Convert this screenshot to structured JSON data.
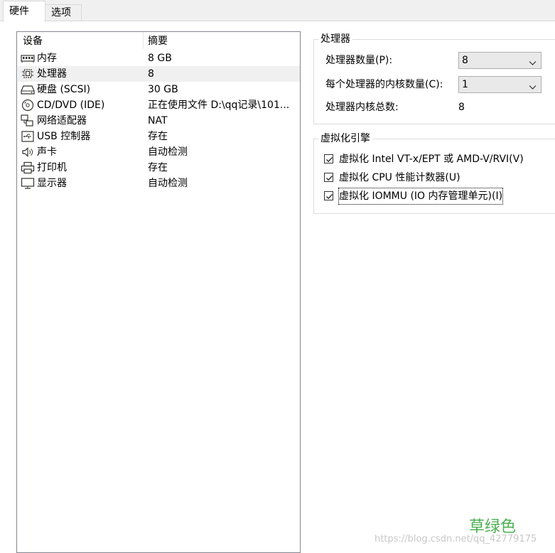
{
  "tabs": [
    {
      "label": "硬件",
      "active": true
    },
    {
      "label": "选项",
      "active": false
    }
  ],
  "device_list": {
    "columns": {
      "device": "设备",
      "summary": "摘要"
    },
    "rows": [
      {
        "icon": "memory-icon",
        "name": "内存",
        "summary": "8 GB",
        "selected": false
      },
      {
        "icon": "processor-icon",
        "name": "处理器",
        "summary": "8",
        "selected": true
      },
      {
        "icon": "hard-disk-icon",
        "name": "硬盘 (SCSI)",
        "summary": "30 GB",
        "selected": false
      },
      {
        "icon": "cd-dvd-icon",
        "name": "CD/DVD (IDE)",
        "summary": "正在使用文件 D:\\qq记录\\101...",
        "selected": false
      },
      {
        "icon": "network-adapter-icon",
        "name": "网络适配器",
        "summary": "NAT",
        "selected": false
      },
      {
        "icon": "usb-icon",
        "name": "USB 控制器",
        "summary": "存在",
        "selected": false
      },
      {
        "icon": "speaker-icon",
        "name": "声卡",
        "summary": "自动检测",
        "selected": false
      },
      {
        "icon": "printer-icon",
        "name": "打印机",
        "summary": "存在",
        "selected": false
      },
      {
        "icon": "monitor-icon",
        "name": "显示器",
        "summary": "自动检测",
        "selected": false
      }
    ]
  },
  "processor": {
    "title": "处理器",
    "count_label": "处理器数量(P):",
    "count_value": "8",
    "cores_label": "每个处理器的内核数量(C):",
    "cores_value": "1",
    "total_label": "处理器内核总数:",
    "total_value": "8"
  },
  "virtualization": {
    "title": "虚拟化引擎",
    "options": [
      {
        "label": "虚拟化 Intel VT-x/EPT 或 AMD-V/RVI(V)",
        "checked": true,
        "focused": false
      },
      {
        "label": "虚拟化 CPU 性能计数器(U)",
        "checked": true,
        "focused": false
      },
      {
        "label": "虚拟化 IOMMU (IO 内存管理单元)(I)",
        "checked": true,
        "focused": true
      }
    ]
  },
  "watermark": {
    "brand": "草绿色",
    "url": "https://blog.csdn.net/qq_42779175"
  },
  "colors": {
    "brand_green": "#4caf50",
    "selection": "#f0f0f0"
  }
}
